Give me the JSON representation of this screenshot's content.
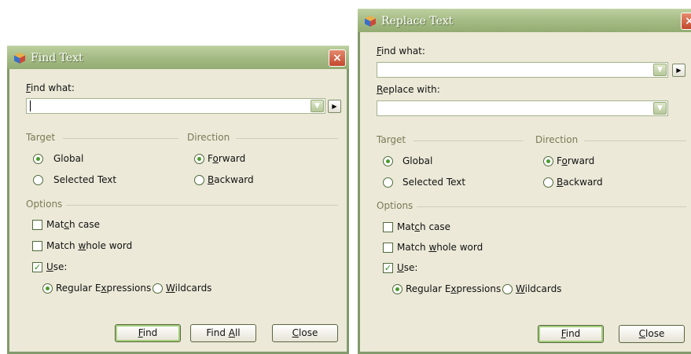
{
  "find_dialog": {
    "title": "Find Text",
    "close_glyph": "×",
    "find_what_label_mnemonic": "F",
    "find_what_label_rest": "ind what:",
    "find_what_value": "",
    "target_label": "Target",
    "direction_label": "Direction",
    "global_label": "Global",
    "selected_text_label": "Selected Text",
    "forward_pre": "F",
    "forward_mnemonic": "o",
    "forward_post": "rward",
    "backward_mnemonic": "B",
    "backward_post": "ackward",
    "options_label": "Options",
    "match_case_pre": "Mat",
    "match_case_mnemonic": "c",
    "match_case_post": "h case",
    "match_whole_pre": "Match ",
    "match_whole_mnemonic": "w",
    "match_whole_post": "hole word",
    "use_mnemonic": "U",
    "use_post": "se:",
    "regex_pre": "Regular E",
    "regex_mnemonic": "x",
    "regex_post": "pressions",
    "wildcards_mnemonic": "W",
    "wildcards_post": "ildcards",
    "find_button_mnemonic": "F",
    "find_button_post": "ind",
    "find_all_pre": "Find ",
    "find_all_mnemonic": "A",
    "find_all_post": "ll",
    "close_button_mnemonic": "C",
    "close_button_post": "lose"
  },
  "replace_dialog": {
    "title": "Replace Text",
    "close_glyph": "×",
    "find_what_label_mnemonic": "F",
    "find_what_label_rest": "ind what:",
    "replace_with_label_mnemonic": "R",
    "replace_with_label_rest": "eplace with:",
    "target_label": "Target",
    "direction_label": "Direction",
    "global_label": "Global",
    "selected_text_label": "Selected Text",
    "forward_pre": "F",
    "forward_mnemonic": "o",
    "forward_post": "rward",
    "backward_mnemonic": "B",
    "backward_post": "ackward",
    "options_label": "Options",
    "match_case_pre": "Mat",
    "match_case_mnemonic": "c",
    "match_case_post": "h case",
    "match_whole_pre": "Match ",
    "match_whole_mnemonic": "w",
    "match_whole_post": "hole word",
    "use_mnemonic": "U",
    "use_post": "se:",
    "regex_pre": "Regular E",
    "regex_mnemonic": "x",
    "regex_post": "pressions",
    "wildcards_mnemonic": "W",
    "wildcards_post": "ildcards",
    "find_button_mnemonic": "F",
    "find_button_post": "ind",
    "close_button_mnemonic": "C",
    "close_button_post": "lose"
  },
  "icons": {
    "title_icon": "app-cube-icon",
    "combo_arrow": "chevron-down-icon",
    "expand_arrow": "arrow-right-icon"
  },
  "state": {
    "target": "Global",
    "direction": "Forward",
    "match_case": false,
    "match_whole_word": false,
    "use": true,
    "use_mode": "Regular Expressions"
  },
  "colors": {
    "titlebar": "#a7bd87",
    "dialog_bg": "#ece9d8",
    "close_button": "#c2482c",
    "check_mark": "#2f8a1e"
  }
}
